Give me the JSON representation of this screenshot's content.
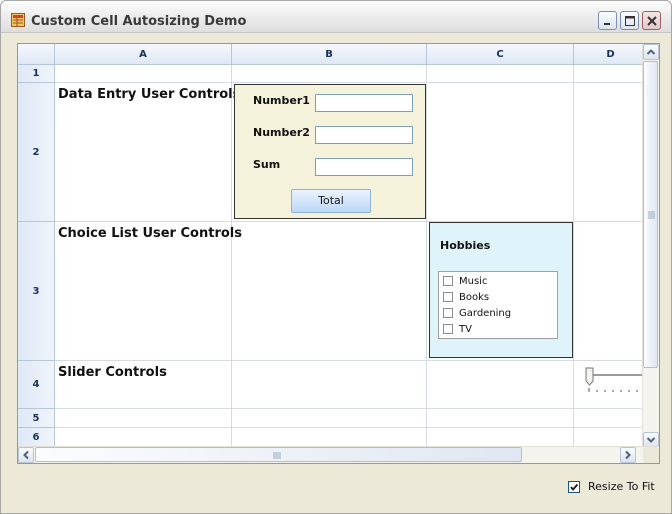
{
  "window": {
    "title": "Custom Cell Autosizing Demo",
    "accent": "#0a246a"
  },
  "grid": {
    "columns": [
      "A",
      "B",
      "C",
      "D"
    ],
    "rows": [
      "1",
      "2",
      "3",
      "4",
      "5",
      "6"
    ],
    "cells": {
      "a2": "Data Entry User Controls",
      "a3": "Choice List User Controls",
      "a4": "Slider Controls"
    }
  },
  "data_entry": {
    "number1_label": "Number1",
    "number2_label": "Number2",
    "sum_label": "Sum",
    "number1_value": "",
    "number2_value": "",
    "sum_value": "",
    "total_button": "Total",
    "background": "#f5f2dc"
  },
  "hobbies": {
    "title": "Hobbies",
    "items": [
      {
        "label": "Music",
        "checked": false
      },
      {
        "label": "Books",
        "checked": false
      },
      {
        "label": "Gardening",
        "checked": false
      },
      {
        "label": "TV",
        "checked": false
      }
    ],
    "background": "#dff3fa"
  },
  "footer": {
    "resize_label": "Resize To Fit",
    "resize_checked": true
  }
}
